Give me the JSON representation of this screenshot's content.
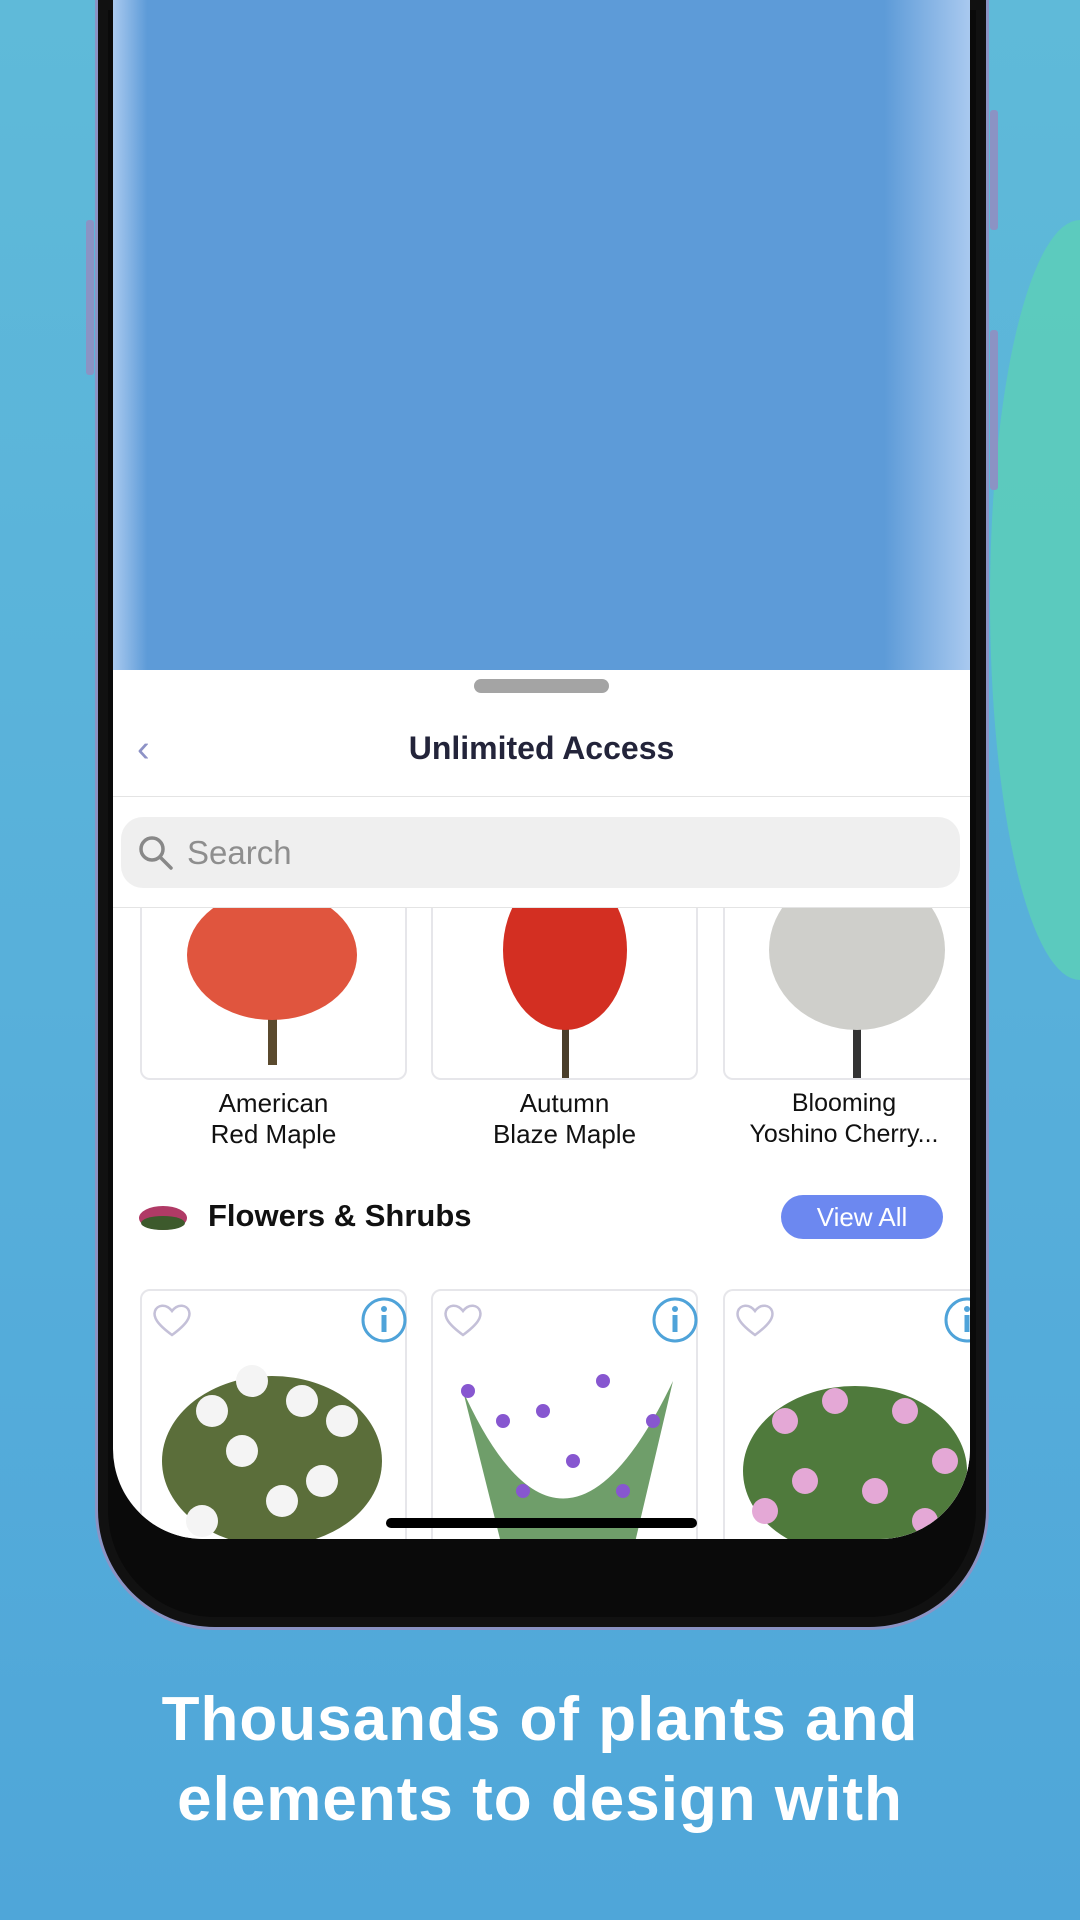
{
  "sheet": {
    "title": "Unlimited Access",
    "search_placeholder": "Search"
  },
  "trees": [
    {
      "name_line1": "American",
      "name_line2": "Red Maple",
      "color": "#e0553e"
    },
    {
      "name_line1": "Autumn",
      "name_line2": "Blaze Maple",
      "color": "#d32f22"
    },
    {
      "name_line1": "Blooming",
      "name_line2": "Yoshino Cherry...",
      "color": "#cfcfcb"
    }
  ],
  "section": {
    "title": "Flowers & Shrubs",
    "view_all": "View All",
    "accent": "#6c88f0"
  },
  "shrubs": [
    {
      "flower_color": "#f4f4f4",
      "leaf_color": "#5b6e3a"
    },
    {
      "flower_color": "#8757d0",
      "leaf_color": "#6f9e6a"
    },
    {
      "flower_color": "#e4a8d6",
      "leaf_color": "#4f7a3c"
    }
  ],
  "caption": {
    "line1": "Thousands of plants and",
    "line2": "elements to design with"
  }
}
